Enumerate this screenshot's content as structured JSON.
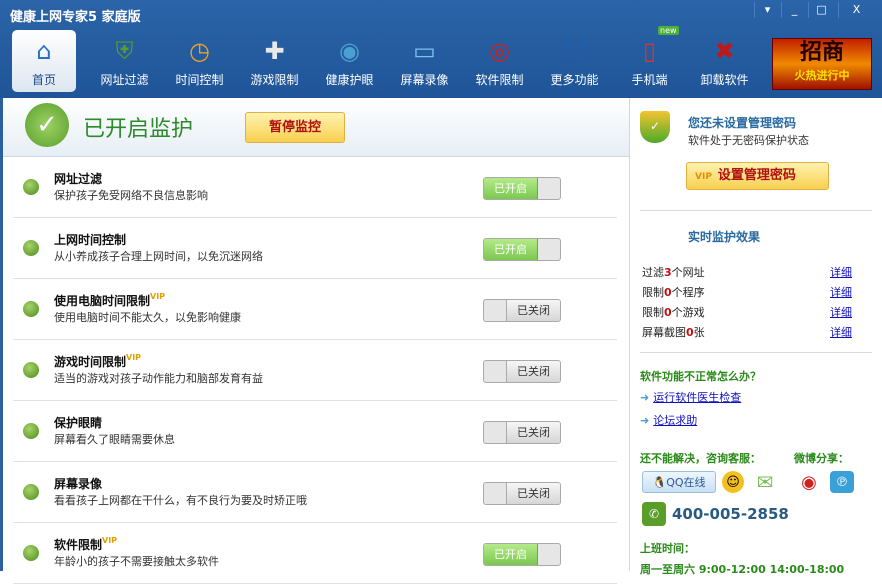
{
  "window": {
    "title": "健康上网专家5 家庭版",
    "buttons": [
      "▾",
      "_",
      "□",
      "X"
    ]
  },
  "nav": [
    {
      "label": "首页",
      "icon": "home-icon",
      "glyph": "⌂",
      "color": "#2a6fc0"
    },
    {
      "label": "网址过滤",
      "icon": "shield-icon",
      "glyph": "⛨",
      "color": "#5a9a2a"
    },
    {
      "label": "时间控制",
      "icon": "clock-icon",
      "glyph": "◷",
      "color": "#f0a020"
    },
    {
      "label": "游戏限制",
      "icon": "gamepad-icon",
      "glyph": "✚",
      "color": "#e8e8e8"
    },
    {
      "label": "健康护眼",
      "icon": "eye-icon",
      "glyph": "◉",
      "color": "#4aa0d0"
    },
    {
      "label": "屏幕录像",
      "icon": "monitor-icon",
      "glyph": "▭",
      "color": "#7ac0f0"
    },
    {
      "label": "软件限制",
      "icon": "disc-icon",
      "glyph": "◎",
      "color": "#d02020"
    },
    {
      "label": "更多功能",
      "icon": "expand-icon",
      "glyph": "⛶",
      "color": "#1a60b0"
    },
    {
      "label": "手机端",
      "icon": "phone-icon",
      "glyph": "▯",
      "color": "#e03030",
      "badge": "new"
    },
    {
      "label": "卸载软件",
      "icon": "uninstall-x-icon",
      "glyph": "✖",
      "color": "#c01818"
    }
  ],
  "ad": {
    "big": "招商",
    "small": "火热进行中"
  },
  "header": {
    "status": "已开启监护",
    "pause": "暂停监控"
  },
  "features": [
    {
      "title": "网址过滤",
      "desc": "保护孩子免受网络不良信息影响",
      "vip": false,
      "state": "已开启",
      "on": true
    },
    {
      "title": "上网时间控制",
      "desc": "从小养成孩子合理上网时间，以免沉迷网络",
      "vip": false,
      "state": "已开启",
      "on": true
    },
    {
      "title": "使用电脑时间限制",
      "desc": "使用电脑时间不能太久，以免影响健康",
      "vip": true,
      "state": "已关闭",
      "on": false
    },
    {
      "title": "游戏时间限制",
      "desc": "适当的游戏对孩子动作能力和脑部发育有益",
      "vip": true,
      "state": "已关闭",
      "on": false
    },
    {
      "title": "保护眼睛",
      "desc": "屏幕看久了眼睛需要休息",
      "vip": false,
      "state": "已关闭",
      "on": false
    },
    {
      "title": "屏幕录像",
      "desc": "看看孩子上网都在干什么，有不良行为要及时矫正哦",
      "vip": false,
      "state": "已关闭",
      "on": false
    },
    {
      "title": "软件限制",
      "desc": "年龄小的孩子不需要接触太多软件",
      "vip": true,
      "state": "已开启",
      "on": true
    }
  ],
  "vip_label": "VIP",
  "side": {
    "pw_title": "您还未设置管理密码",
    "pw_desc": "软件处于无密码保护状态",
    "set_pw": "设置管理密码",
    "monitor_title": "实时监护效果",
    "stats": [
      {
        "pre": "过滤",
        "num": "3",
        "post": "个网址",
        "link": "详细"
      },
      {
        "pre": "限制",
        "num": "0",
        "post": "个程序",
        "link": "详细"
      },
      {
        "pre": "限制",
        "num": "0",
        "post": "个游戏",
        "link": "详细"
      },
      {
        "pre": "屏幕截图",
        "num": "0",
        "post": "张",
        "link": "详细"
      }
    ],
    "help_title": "软件功能不正常怎么办？",
    "links": [
      "运行软件医生检查",
      "论坛求助"
    ],
    "service": "还不能解决，咨询客服：",
    "weibo": "微博分享：",
    "qq": "QQ在线",
    "phone": "400-005-2858",
    "hours_title": "上班时间：",
    "hours": "周一至周六 9:00-12:00 14:00-18:00"
  }
}
